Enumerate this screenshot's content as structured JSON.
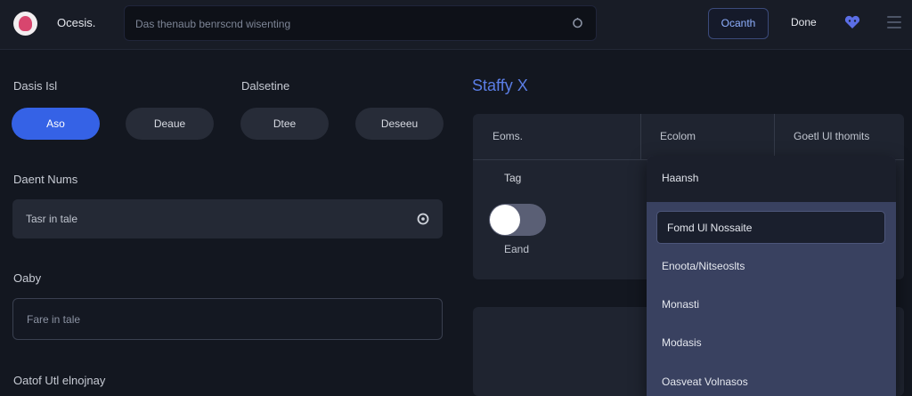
{
  "header": {
    "app_title": "Ocesis.",
    "search_placeholder": "Das thenaub benrscnd wisenting",
    "primary_button": "Ocanth",
    "secondary_link": "Done"
  },
  "form": {
    "group1_label": "Dasis Isl",
    "group2_label": "Dalsetine",
    "pills": [
      {
        "label": "Aso",
        "active": true
      },
      {
        "label": "Deaue",
        "active": false
      },
      {
        "label": "Dtee",
        "active": false
      },
      {
        "label": "Deseeu",
        "active": false
      }
    ],
    "field1_label": "Daent Nums",
    "field1_value": "Tasr in tale",
    "field2_label": "Oaby",
    "field2_placeholder": "Fare in tale",
    "field3_label": "Oatof Utl elnojnay"
  },
  "modal": {
    "title": "Staffy X",
    "columns": [
      "Eoms.",
      "Ecolom",
      "Goetl Ul thomits"
    ],
    "toggle_label": "Tag",
    "toggle_on": true,
    "toggle_sub": "Eand",
    "dropdown": {
      "header": "Haansh",
      "items": [
        {
          "label": "Fomd Ul Nossaite",
          "selected": true
        },
        {
          "label": "Enoota/Nitseoslts",
          "selected": false
        },
        {
          "label": "Monasti",
          "selected": false
        },
        {
          "label": "Modasis",
          "selected": false
        },
        {
          "label": "Oasveat Volnasos",
          "selected": false
        }
      ]
    }
  },
  "colors": {
    "accent": "#3562e6",
    "title_accent": "#5b7ee6",
    "background": "#131720"
  }
}
